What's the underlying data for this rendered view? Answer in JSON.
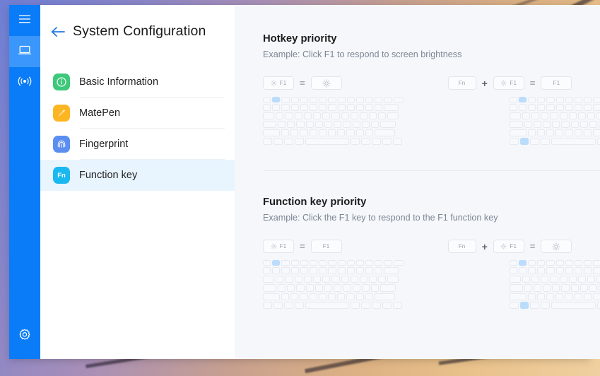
{
  "window": {
    "title": "System Configuration",
    "controls": {
      "minimize": "minimize-button",
      "close": "close-button"
    }
  },
  "rail": {
    "items": [
      {
        "name": "menu",
        "icon": "hamburger-menu-icon",
        "active": false
      },
      {
        "name": "device",
        "icon": "laptop-icon",
        "active": true
      },
      {
        "name": "connect",
        "icon": "wireless-signal-icon",
        "active": false
      }
    ],
    "bottom": {
      "name": "settings",
      "icon": "gear-icon"
    },
    "accent": "#0a7cf7",
    "accent_active": "#3b97fb"
  },
  "sidebar": {
    "back_label": "back-arrow",
    "items": [
      {
        "label": "Basic Information",
        "icon": "info-circle-icon",
        "color": "#3dc87a",
        "selected": false
      },
      {
        "label": "MatePen",
        "icon": "pen-icon",
        "color": "#fdb623",
        "selected": false
      },
      {
        "label": "Fingerprint",
        "icon": "fingerprint-icon",
        "color": "#5b8ef0",
        "selected": false
      },
      {
        "label": "Function key",
        "icon": "fn-key-icon",
        "color": "#19b8f0",
        "selected": true,
        "icon_text": "Fn"
      }
    ],
    "selected_bg": "#e8f4fe"
  },
  "sections": [
    {
      "title": "Hotkey priority",
      "subtitle": "Example: Click F1 to respond to screen brightness",
      "selected": true,
      "left_formula": {
        "keys": [
          {
            "type": "sun-f1",
            "label": "F1",
            "icon": "sun-brightness-icon"
          },
          {
            "type": "op",
            "label": "="
          },
          {
            "type": "sun",
            "icon": "sun-brightness-icon"
          }
        ]
      },
      "right_formula": {
        "keys": [
          {
            "type": "text",
            "label": "Fn"
          },
          {
            "type": "op",
            "label": "+"
          },
          {
            "type": "sun-f1",
            "label": "F1",
            "icon": "sun-brightness-icon"
          },
          {
            "type": "op",
            "label": "="
          },
          {
            "type": "text",
            "label": "F1"
          }
        ]
      },
      "left_keyboard_highlights": [
        "f1"
      ],
      "right_keyboard_highlights": [
        "f1",
        "fn"
      ]
    },
    {
      "title": "Function key priority",
      "subtitle": "Example: Click the F1 key to respond to the F1 function key",
      "selected": false,
      "left_formula": {
        "keys": [
          {
            "type": "sun-f1",
            "label": "F1",
            "icon": "sun-brightness-icon"
          },
          {
            "type": "op",
            "label": "="
          },
          {
            "type": "text",
            "label": "F1"
          }
        ]
      },
      "right_formula": {
        "keys": [
          {
            "type": "text",
            "label": "Fn"
          },
          {
            "type": "op",
            "label": "+"
          },
          {
            "type": "sun-f1",
            "label": "F1",
            "icon": "sun-brightness-icon"
          },
          {
            "type": "op",
            "label": "="
          },
          {
            "type": "sun",
            "icon": "sun-brightness-icon"
          }
        ]
      },
      "left_keyboard_highlights": [
        "f1"
      ],
      "right_keyboard_highlights": [
        "f1",
        "fn"
      ]
    }
  ],
  "theme": {
    "content_bg": "#f5f7fb",
    "panel_bg": "#ffffff",
    "key_highlight": "#bcdcfb",
    "title_color": "#1d1d1d",
    "sub_color": "#7c8694"
  }
}
